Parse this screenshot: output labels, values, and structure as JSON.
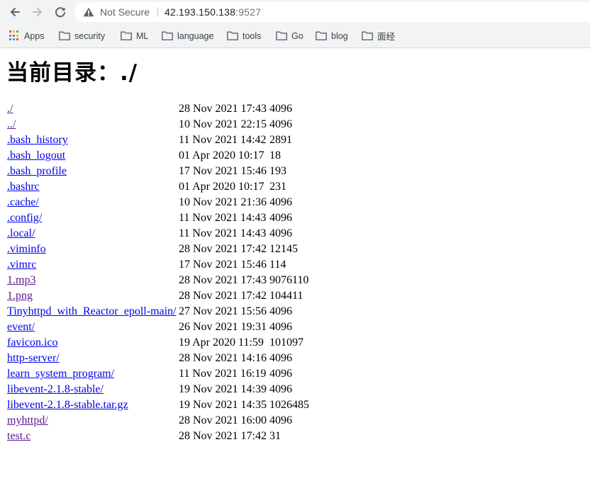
{
  "browser": {
    "security_label": "Not Secure",
    "url_host": "42.193.150.138",
    "url_port": ":9527"
  },
  "bookmarks": [
    {
      "label": "Apps",
      "icon": "apps-grid-icon"
    },
    {
      "label": "security",
      "icon": "folder-icon"
    },
    {
      "label": "ML",
      "icon": "folder-icon"
    },
    {
      "label": "language",
      "icon": "folder-icon"
    },
    {
      "label": "tools",
      "icon": "folder-icon"
    },
    {
      "label": "Go",
      "icon": "folder-icon"
    },
    {
      "label": "blog",
      "icon": "folder-icon"
    },
    {
      "label": "面经",
      "icon": "folder-icon"
    }
  ],
  "page": {
    "heading": "当前目录：./"
  },
  "files": [
    {
      "name": "./",
      "date": "28 Nov 2021 17:43",
      "size": "4096",
      "visited": true
    },
    {
      "name": "../",
      "date": "10 Nov 2021 22:15",
      "size": "4096",
      "visited": true
    },
    {
      "name": ".bash_history",
      "date": "11 Nov 2021 14:42",
      "size": "2891",
      "visited": false
    },
    {
      "name": ".bash_logout",
      "date": "01 Apr 2020 10:17",
      "size": " 18",
      "visited": false
    },
    {
      "name": ".bash_profile",
      "date": "17 Nov 2021 15:46",
      "size": "193",
      "visited": false
    },
    {
      "name": ".bashrc",
      "date": "01 Apr 2020 10:17",
      "size": " 231",
      "visited": false
    },
    {
      "name": ".cache/",
      "date": "10 Nov 2021 21:36",
      "size": "4096",
      "visited": false
    },
    {
      "name": ".config/",
      "date": "11 Nov 2021 14:43",
      "size": "4096",
      "visited": false
    },
    {
      "name": ".local/",
      "date": "11 Nov 2021 14:43",
      "size": "4096",
      "visited": false
    },
    {
      "name": ".viminfo",
      "date": "28 Nov 2021 17:42",
      "size": "12145",
      "visited": false
    },
    {
      "name": ".vimrc",
      "date": "17 Nov 2021 15:46",
      "size": "114",
      "visited": false
    },
    {
      "name": "1.mp3",
      "date": "28 Nov 2021 17:43",
      "size": "9076110",
      "visited": true
    },
    {
      "name": "1.png",
      "date": "28 Nov 2021 17:42",
      "size": "104411",
      "visited": true
    },
    {
      "name": "Tinyhttpd_with_Reactor_epoll-main/",
      "date": "27 Nov 2021 15:56",
      "size": "4096",
      "visited": false
    },
    {
      "name": "event/",
      "date": "26 Nov 2021 19:31",
      "size": "4096",
      "visited": false
    },
    {
      "name": "favicon.ico",
      "date": "19 Apr 2020 11:59",
      "size": " 101097",
      "visited": false
    },
    {
      "name": "http-server/",
      "date": "28 Nov 2021 14:16",
      "size": "4096",
      "visited": false
    },
    {
      "name": "learn_system_program/",
      "date": "11 Nov 2021 16:19",
      "size": "4096",
      "visited": false
    },
    {
      "name": "libevent-2.1.8-stable/",
      "date": "19 Nov 2021 14:39",
      "size": "4096",
      "visited": false
    },
    {
      "name": "libevent-2.1.8-stable.tar.gz",
      "date": "19 Nov 2021 14:35",
      "size": "1026485",
      "visited": false
    },
    {
      "name": "myhttpd/",
      "date": "28 Nov 2021 16:00",
      "size": "4096",
      "visited": true
    },
    {
      "name": "test.c",
      "date": "28 Nov 2021 17:42",
      "size": "31",
      "visited": true
    }
  ],
  "colors": {
    "link": "#0000ee",
    "visited_link": "#551a8b",
    "chrome_bg": "#f1f3f4"
  }
}
